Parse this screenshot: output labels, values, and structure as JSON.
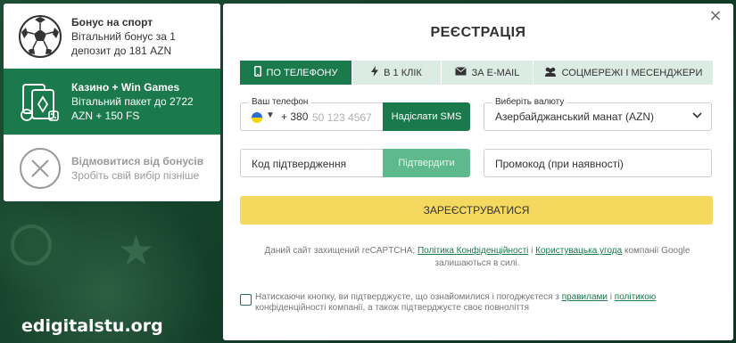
{
  "watermark": "edigitalstu.org",
  "bonuses": {
    "sport": {
      "title": "Бонус на спорт",
      "desc": "Вітальний бонус за 1 депозит до 181 AZN",
      "icon": "soccer-ball-icon"
    },
    "casino": {
      "title": "Казино + Win Games",
      "desc": "Вітальний пакет до 2722 AZN + 150 FS",
      "icon": "casino-cards-icon"
    },
    "decline": {
      "title": "Відмовитися від бонусів",
      "desc": "Зробіть свій вибір пізніше",
      "icon": "close-circle-icon"
    }
  },
  "modal": {
    "title": "РЕЄСТРАЦІЯ",
    "close": "×",
    "tabs": [
      {
        "label": "По телефону",
        "icon": "phone-icon",
        "active": true
      },
      {
        "label": "В 1 клік",
        "icon": "lightning-icon",
        "active": false
      },
      {
        "label": "За e-mail",
        "icon": "envelope-icon",
        "active": false
      },
      {
        "label": "Соцмережі і месенджери",
        "icon": "users-icon",
        "active": false
      }
    ],
    "phone": {
      "legend": "Ваш телефон",
      "code": "+ 380",
      "placeholder": "50 123 4567",
      "sms_button": "Надіслати SMS"
    },
    "currency": {
      "legend": "Виберіть валюту",
      "value": "Азербайджанський манат (AZN)"
    },
    "code_field": {
      "placeholder": "Код підтвердження",
      "confirm_button": "Підтвердити"
    },
    "promo": {
      "placeholder": "Промокод (при наявності)"
    },
    "register_button": "Зареєструватися",
    "recaptcha": {
      "pre": "Даний сайт захищений reCAPTCHA;",
      "privacy_link": "Політика Конфіденційності",
      "and": "і",
      "terms_link": "Користувацька угода",
      "post": "компанії Google залишаються в силі."
    },
    "consent": {
      "pre": "Натискаючи кнопку, ви підтверджуєте, що ознайомилися і погоджуєтеся з",
      "rules_link": "правилами",
      "and": "і",
      "policy_link": "політикою",
      "post": "конфіденційності компанії, а також підтверджуєте своє повноліття"
    }
  },
  "colors": {
    "accent": "#1a7a4c",
    "register": "#f5d85e",
    "tab_bg": "#dbece4"
  }
}
